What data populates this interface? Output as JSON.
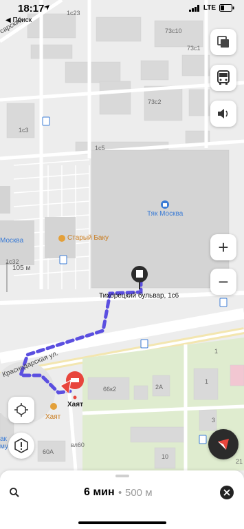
{
  "status_bar": {
    "time": "18:17",
    "back_label": "◀ Поиск",
    "network": "LTE"
  },
  "map": {
    "building_labels": [
      "1с23",
      "73с10",
      "73с1",
      "1с3",
      "73с2",
      "1с5",
      "1с32",
      "66к2",
      "2А",
      "1",
      "3",
      "60А",
      "вл60",
      "10",
      "1",
      "21"
    ],
    "street_labels": [
      "Краснодарская ул.",
      "сарский"
    ],
    "poi": {
      "mall": "Тяк Москва",
      "cafe": "Старый Баку",
      "hotel_small": "Хаят",
      "hotel_pin": "Хаят",
      "left_edge": "Москва",
      "left_edge_bottom": "ак\nму"
    },
    "destination_label": "Тихорецкий бульвар, 1с6",
    "scale_label": "105 м"
  },
  "controls": {
    "layers_icon": "layers-icon",
    "transport_icon": "bus-icon",
    "sound_icon": "speaker-icon",
    "zoom_in": "+",
    "zoom_out": "−",
    "view_icon": "3d-view-icon",
    "alert_icon": "alert-icon",
    "compass_icon": "compass-icon"
  },
  "route": {
    "time": "6 мин",
    "separator": "•",
    "distance": "500 м"
  },
  "colors": {
    "route": "#5b4fe0",
    "pin_red": "#e8453c",
    "poi_orange": "#c97b1d",
    "poi_blue": "#3a7bd5"
  }
}
